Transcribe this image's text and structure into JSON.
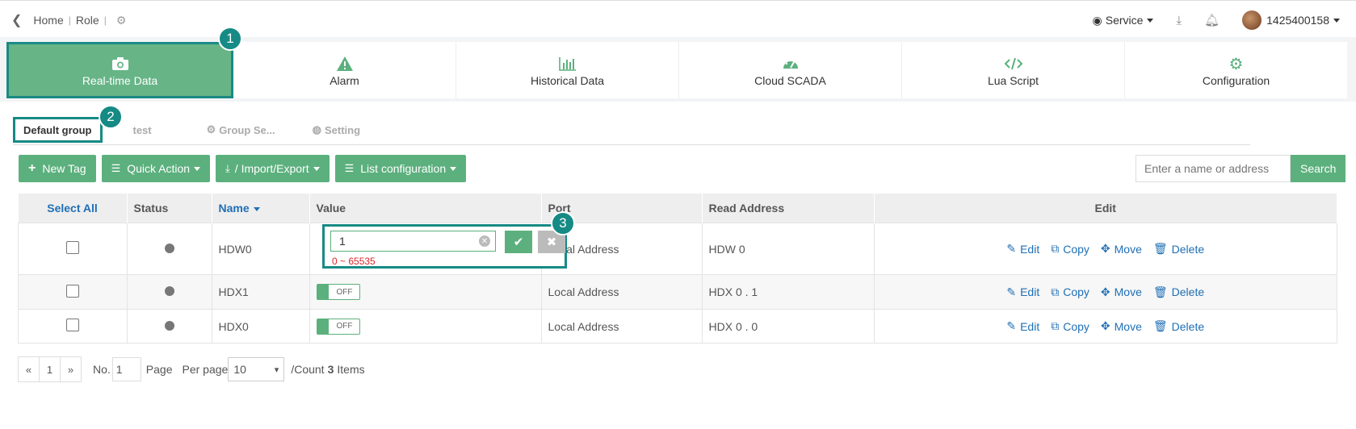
{
  "breadcrumb": {
    "home": "Home",
    "role": "Role"
  },
  "header": {
    "service_label": "Service",
    "user": "1425400158"
  },
  "modules": [
    {
      "label": "Real-time Data",
      "icon": "camera-icon"
    },
    {
      "label": "Alarm",
      "icon": "warning-icon"
    },
    {
      "label": "Historical Data",
      "icon": "bar-chart-icon"
    },
    {
      "label": "Cloud SCADA",
      "icon": "dashboard-icon"
    },
    {
      "label": "Lua Script",
      "icon": "code-icon"
    },
    {
      "label": "Configuration",
      "icon": "gear-icon"
    }
  ],
  "tabs": [
    {
      "label": "Default group"
    },
    {
      "label": "test"
    },
    {
      "label": "Group Se..."
    },
    {
      "label": "Setting"
    }
  ],
  "toolbar": {
    "new_tag": "New Tag",
    "quick_action": "Quick Action",
    "import_export": "/ Import/Export",
    "list_config": "List configuration"
  },
  "search": {
    "placeholder": "Enter a name or address",
    "button": "Search"
  },
  "table": {
    "headers": [
      "Select All",
      "Status",
      "Name",
      "Value",
      "Port",
      "Read Address",
      "Edit"
    ],
    "rows": [
      {
        "name": "HDW0",
        "value": "1",
        "port": "Local Address",
        "read_address": "HDW 0"
      },
      {
        "name": "HDX1",
        "value": "OFF",
        "port": "Local Address",
        "read_address": "HDX 0 . 1"
      },
      {
        "name": "HDX0",
        "value": "OFF",
        "port": "Local Address",
        "read_address": "HDX 0 . 0"
      }
    ],
    "actions": {
      "edit": "Edit",
      "copy": "Copy",
      "move": "Move",
      "delete": "Delete"
    }
  },
  "value_range": "0 ~ 65535",
  "annotations": [
    "1",
    "2",
    "3"
  ],
  "pager": {
    "prev": "«",
    "current": "1",
    "next": "»",
    "no_label": "No.",
    "no_value": "1",
    "page_label": "Page",
    "per_page_label": "Per page",
    "per_page_value": "10",
    "count_prefix": "/Count",
    "count": "3",
    "count_suffix": "Items"
  },
  "colors": {
    "accent": "#5cb07d",
    "highlight": "#168a85",
    "link": "#1f6fb5",
    "error": "#d9262b"
  }
}
